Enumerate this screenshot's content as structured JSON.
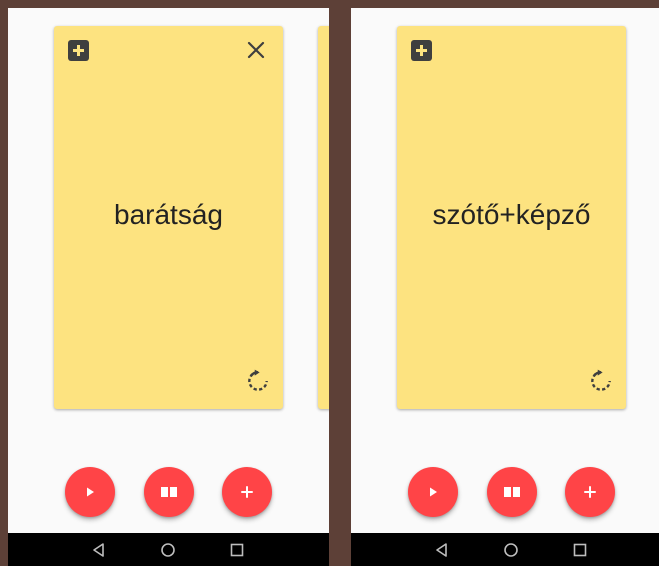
{
  "screens": [
    {
      "card_word": "barátság",
      "has_close": true,
      "has_peek_card": true
    },
    {
      "card_word": "szótő+képző",
      "has_close": false,
      "has_peek_card": false
    }
  ],
  "icons": {
    "add_card": "plus-square-icon",
    "close": "close-icon",
    "flip": "flip-rotate-icon",
    "play": "play-icon",
    "book": "book-icon",
    "add": "plus-icon",
    "nav_back": "triangle-back-icon",
    "nav_home": "circle-home-icon",
    "nav_recent": "square-recent-icon"
  },
  "colors": {
    "background": "#5d4037",
    "screen": "#fafafa",
    "card": "#fde380",
    "fab": "#ff4447",
    "navbar": "#000000"
  }
}
